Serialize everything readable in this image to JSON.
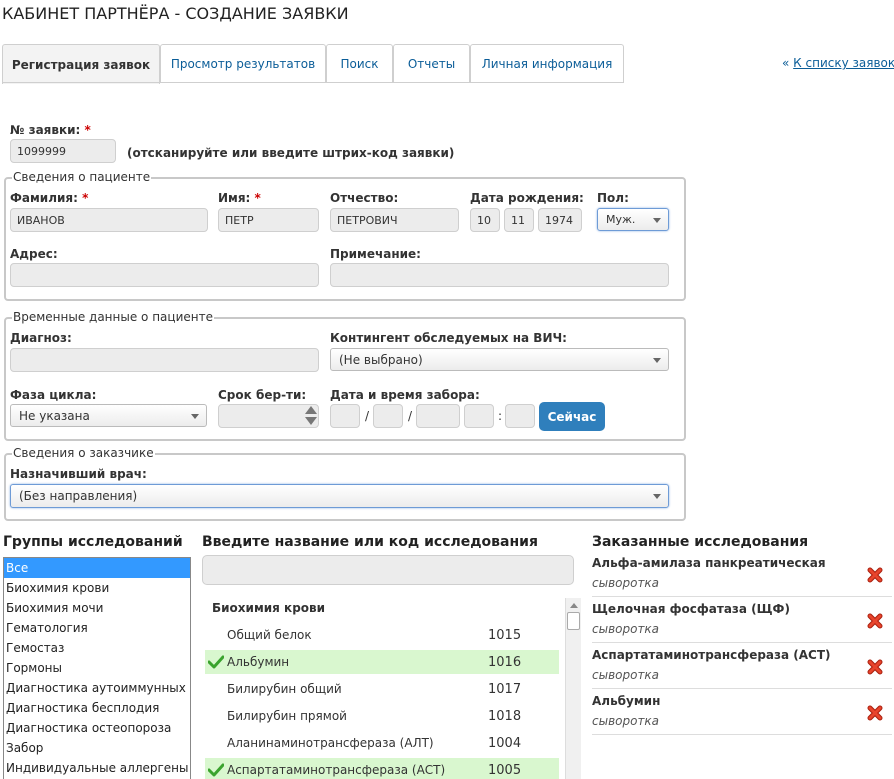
{
  "header": {
    "title": "КАБИНЕТ ПАРТНЁРА - СОЗДАНИЕ ЗАЯВКИ"
  },
  "tabs": [
    {
      "label": "Регистрация заявок"
    },
    {
      "label": "Просмотр результатов"
    },
    {
      "label": "Поиск"
    },
    {
      "label": "Отчеты"
    },
    {
      "label": "Личная информация"
    }
  ],
  "back_link": {
    "arrows": "«",
    "label": "К списку заявок"
  },
  "order": {
    "number_label": "№ заявки:",
    "number_value": "1099999",
    "hint": "(отсканируйте или введите штрих-код заявки)"
  },
  "patient": {
    "legend": "Сведения о пациенте",
    "surname_label": "Фамилия:",
    "surname": "ИВАНОВ",
    "name_label": "Имя:",
    "name": "ПЕТР",
    "patronymic_label": "Отчество:",
    "patronymic": "ПЕТРОВИЧ",
    "birth_label": "Дата рождения:",
    "birth_day": "10",
    "birth_month": "11",
    "birth_year": "1974",
    "sex_label": "Пол:",
    "sex": "Муж.",
    "address_label": "Адрес:",
    "address": "",
    "note_label": "Примечание:",
    "note": ""
  },
  "temp": {
    "legend": "Временные данные о пациенте",
    "diagnosis_label": "Диагноз:",
    "hiv_label": "Контингент обследуемых на ВИЧ:",
    "hiv_value": "(Не выбрано)",
    "phase_label": "Фаза цикла:",
    "phase_value": "Не указана",
    "term_label": "Срок бер-ти:",
    "collect_label": "Дата и время забора:",
    "slash": "/",
    "colon": ":",
    "now_button": "Сейчас"
  },
  "customer": {
    "legend": "Сведения о заказчике",
    "doctor_label": "Назначивший врач:",
    "doctor_value": "(Без направления)"
  },
  "groups": {
    "title": "Группы исследований",
    "items": [
      "Все",
      "Биохимия крови",
      "Биохимия мочи",
      "Гематология",
      "Гемостаз",
      "Гормоны",
      "Диагностика аутоиммунных за",
      "Диагностика бесплодия",
      "Диагностика остеопороза",
      "Забор",
      "Индивидуальные аллергены"
    ],
    "selected": 0
  },
  "tests": {
    "title": "Введите название или код исследования",
    "group_header": "Биохимия крови",
    "rows": [
      {
        "name": "Общий белок",
        "code": "1015",
        "checked": false
      },
      {
        "name": "Альбумин",
        "code": "1016",
        "checked": true
      },
      {
        "name": "Билирубин общий",
        "code": "1017",
        "checked": false
      },
      {
        "name": "Билирубин прямой",
        "code": "1018",
        "checked": false
      },
      {
        "name": "Аланинаминотрансфераза (АЛТ)",
        "code": "1004",
        "checked": false
      },
      {
        "name": "Аспартатаминотрансфераза (АСТ)",
        "code": "1005",
        "checked": true
      }
    ]
  },
  "ordered": {
    "title": "Заказанные исследования",
    "items": [
      {
        "name": "Альфа-амилаза панкреатическая",
        "material": "сыворотка"
      },
      {
        "name": "Щелочная фосфатаза (ЩФ)",
        "material": "сыворотка"
      },
      {
        "name": "Аспартатаминотрансфераза (АСТ)",
        "material": "сыворотка"
      },
      {
        "name": "Альбумин",
        "material": "сыворотка"
      }
    ]
  },
  "colors": {
    "accent": "#2f7fbc",
    "link": "#0b5d98",
    "selected": "#3399ff",
    "checked_row": "#d9f7cf",
    "delete": "#d9321f"
  },
  "icons": {
    "check": "check-icon",
    "delete": "delete-icon"
  }
}
